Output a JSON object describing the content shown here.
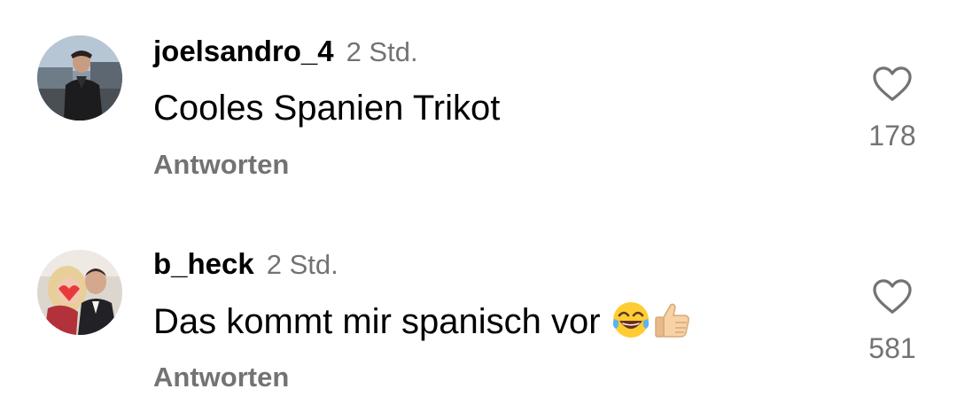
{
  "comments": [
    {
      "username": "joelsandro_4",
      "time": "2 Std.",
      "text": "Cooles Spanien Trikot",
      "emojis": [],
      "reply_label": "Antworten",
      "likes": "178",
      "avatar_icon": "avatar-photo-man-leather-jacket"
    },
    {
      "username": "b_heck",
      "time": "2 Std.",
      "text": "Das kommt mir spanisch vor",
      "emojis": [
        "tears-of-joy-emoji",
        "thumbs-up-emoji"
      ],
      "reply_label": "Antworten",
      "likes": "581",
      "avatar_icon": "avatar-photo-couple"
    }
  ],
  "colors": {
    "secondary_text": "#737373",
    "primary_text": "#000000",
    "background": "#ffffff"
  },
  "icons": {
    "like": "heart-outline-icon"
  }
}
